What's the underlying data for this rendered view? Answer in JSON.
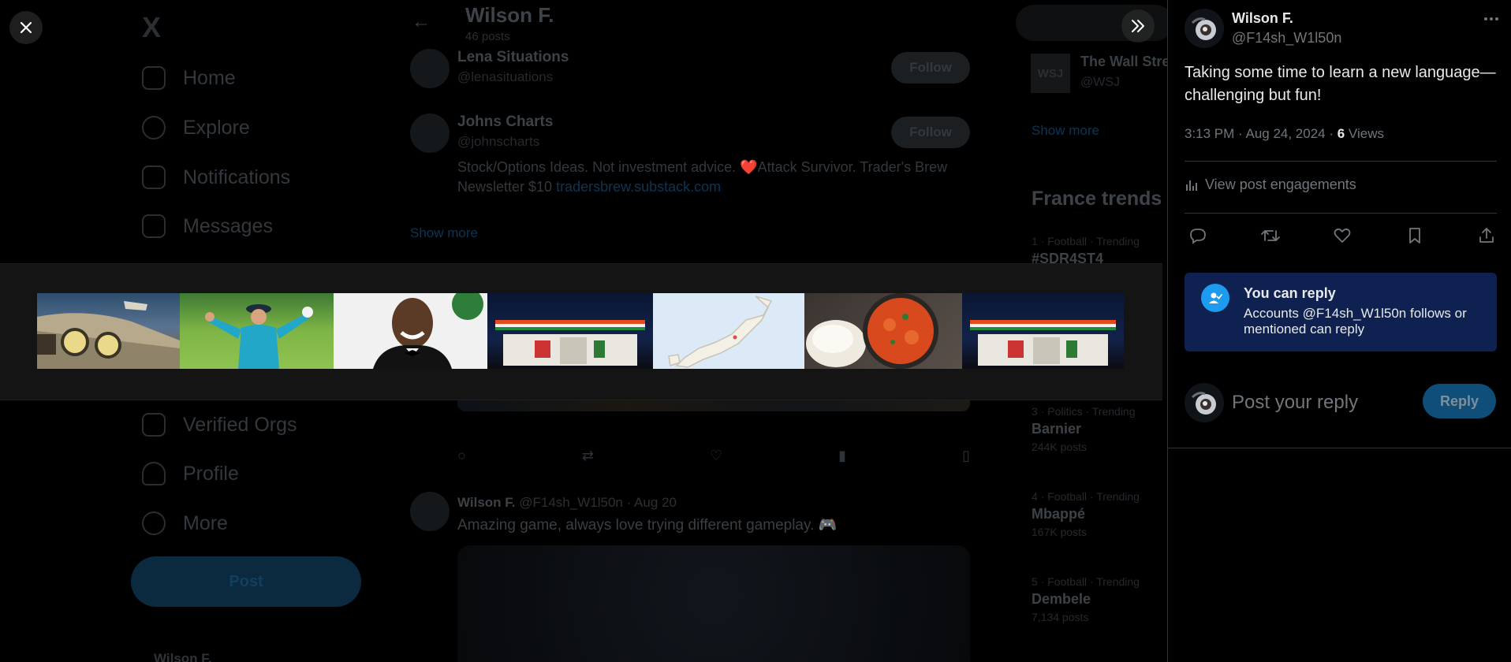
{
  "background": {
    "nav": {
      "logo": "X",
      "items": [
        {
          "label": "Home",
          "icon": "home-icon"
        },
        {
          "label": "Explore",
          "icon": "search-icon"
        },
        {
          "label": "Notifications",
          "icon": "bell-icon"
        },
        {
          "label": "Messages",
          "icon": "mail-icon"
        },
        {
          "label": "Verified Orgs",
          "icon": "lightning-icon"
        },
        {
          "label": "Profile",
          "icon": "person-icon"
        },
        {
          "label": "More",
          "icon": "more-circle-icon"
        }
      ],
      "post_button": "Post",
      "account_name": "Wilson F."
    },
    "header": {
      "title": "Wilson F.",
      "subtitle": "46 posts"
    },
    "who_to_follow": [
      {
        "name": "Lena Situations",
        "handle": "@lenasituations",
        "button": "Follow"
      },
      {
        "name": "Johns Charts",
        "handle": "@johnscharts",
        "button": "Follow",
        "bio": "Stock/Options Ideas. Not investment advice. ❤️Attack Survivor. Trader's Brew Newsletter $10 ",
        "bio_link": "tradersbrew.substack.com"
      }
    ],
    "show_more": "Show more",
    "post2": {
      "name": "Wilson F.",
      "handle": "@F14sh_W1l50n",
      "date": "· Aug 20",
      "text": "Amazing game, always love trying different gameplay. 🎮"
    },
    "right_col": {
      "wsj_name": "The Wall Street Journal",
      "wsj_handle": "@WSJ",
      "show_more": "Show more",
      "trends_title": "France trends for you",
      "trends": [
        {
          "category": "1 · Football · Trending",
          "name": "#SDR4ST4",
          "posts": ""
        },
        {
          "category": "3 · Politics · Trending",
          "name": "Barnier",
          "posts": "244K posts"
        },
        {
          "category": "4 · Football · Trending",
          "name": "Mbappé",
          "posts": "167K posts"
        },
        {
          "category": "5 · Football · Trending",
          "name": "Dembele",
          "posts": "7,134 posts"
        }
      ]
    }
  },
  "overlay": {
    "close_icon": "close-icon",
    "expand_icon": "chevrons-right-icon",
    "thumbnails": [
      {
        "name": "vintage-car-photo",
        "colors": [
          "#2a3f55",
          "#b8a98c"
        ]
      },
      {
        "name": "golfer-photo",
        "colors": [
          "#2f6f2a",
          "#8cc04b"
        ]
      },
      {
        "name": "man-in-tuxedo-photo",
        "colors": [
          "#f2f2f2",
          "#1a1a1a"
        ]
      },
      {
        "name": "convenience-store-night-photo",
        "colors": [
          "#0e1a35",
          "#e8e8e8"
        ]
      },
      {
        "name": "japan-map-image",
        "colors": [
          "#dbeaf5",
          "#f4f1e8"
        ]
      },
      {
        "name": "curry-dish-photo",
        "colors": [
          "#d4461d",
          "#efeae2"
        ]
      },
      {
        "name": "convenience-store-night-photo-2",
        "colors": [
          "#0e1a35",
          "#e8e8e8"
        ]
      }
    ]
  },
  "post": {
    "author_name": "Wilson F.",
    "author_handle": "@F14sh_W1l50n",
    "text": "Taking some time to learn a new language—challenging but fun!",
    "time": "3:13 PM · Aug 24, 2024 · ",
    "views_count": "6",
    "views_label": " Views",
    "engagements_label": "View post engagements",
    "reply_notice_title": "You can reply",
    "reply_notice_body": "Accounts @F14sh_W1l50n follows or mentioned can reply",
    "reply_placeholder": "Post your reply",
    "reply_button": "Reply"
  },
  "colors": {
    "accent": "#1d9bf0",
    "background": "#000000",
    "notice_bg": "#0f2150",
    "muted": "#71767b"
  }
}
